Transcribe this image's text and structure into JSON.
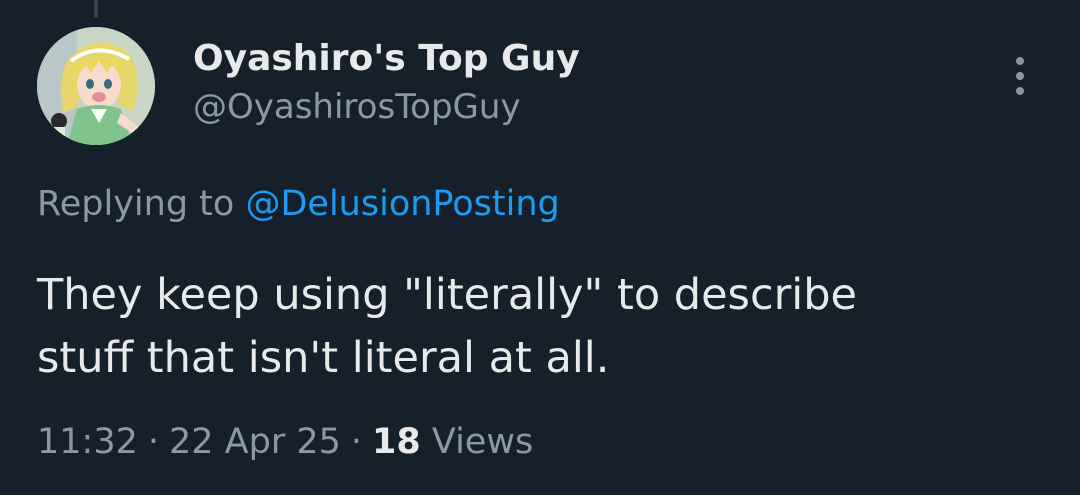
{
  "tweet": {
    "author": {
      "display_name": "Oyashiro's Top Guy",
      "handle": "@OyashirosTopGuy",
      "avatar_icon": "anime-character-avatar"
    },
    "reply": {
      "prefix": "Replying to",
      "target": "@DelusionPosting"
    },
    "text_line1": "They keep using \"literally\" to describe",
    "text_line2": "stuff that isn't literal at all.",
    "meta": {
      "time": "11:32",
      "separator": "·",
      "date": "22 Apr 25",
      "views_count": "18",
      "views_label": "Views"
    }
  },
  "more_menu_icon": "more-vertical-icon",
  "colors": {
    "background": "#15202b",
    "primary_text": "#e7e9ea",
    "secondary_text": "#8b98a5",
    "link": "#1d9bf0"
  }
}
